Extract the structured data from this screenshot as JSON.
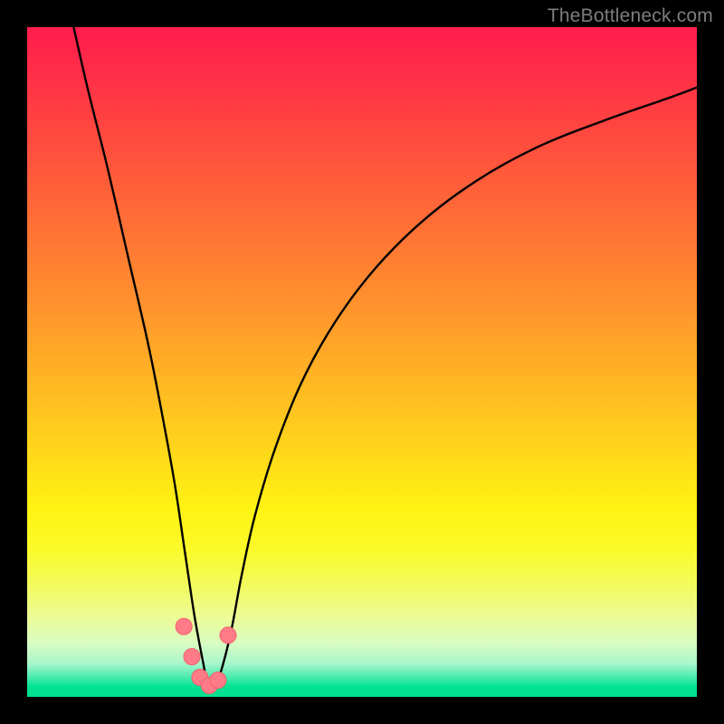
{
  "watermark": {
    "text": "TheBottleneck.com"
  },
  "colors": {
    "frame": "#000000",
    "curve_stroke": "#000000",
    "marker_fill": "#ff7b87",
    "marker_stroke": "#f1606d",
    "gradient_top": "#ff1d4c",
    "gradient_bottom": "#00df8c"
  },
  "chart_data": {
    "type": "line",
    "title": "",
    "xlabel": "",
    "ylabel": "",
    "xlim": [
      0,
      100
    ],
    "ylim": [
      0,
      100
    ],
    "note": "Gradient background ranges red (top, high bottleneck) to green (bottom, no bottleneck). Curve shows bottleneck % vs an implicit x parameter. Minimum near x≈27.",
    "series": [
      {
        "name": "bottleneck-curve",
        "x": [
          6.5,
          9,
          12,
          15,
          18,
          20,
          22,
          23.5,
          25,
          26.3,
          27,
          28,
          29,
          30.5,
          32,
          34,
          37,
          41,
          46,
          52,
          59,
          67,
          76,
          86,
          96,
          100
        ],
        "values": [
          102,
          91,
          79,
          66,
          53,
          43,
          32,
          22,
          12,
          5,
          1.7,
          1.6,
          4,
          10,
          18,
          27,
          37,
          47,
          56,
          64,
          71,
          77,
          82,
          86,
          89.5,
          91
        ]
      }
    ],
    "markers": [
      {
        "x": 23.4,
        "y": 10.5
      },
      {
        "x": 24.6,
        "y": 6.0
      },
      {
        "x": 25.8,
        "y": 2.9
      },
      {
        "x": 27.2,
        "y": 1.7
      },
      {
        "x": 28.5,
        "y": 2.5
      },
      {
        "x": 30.0,
        "y": 9.2
      }
    ]
  }
}
